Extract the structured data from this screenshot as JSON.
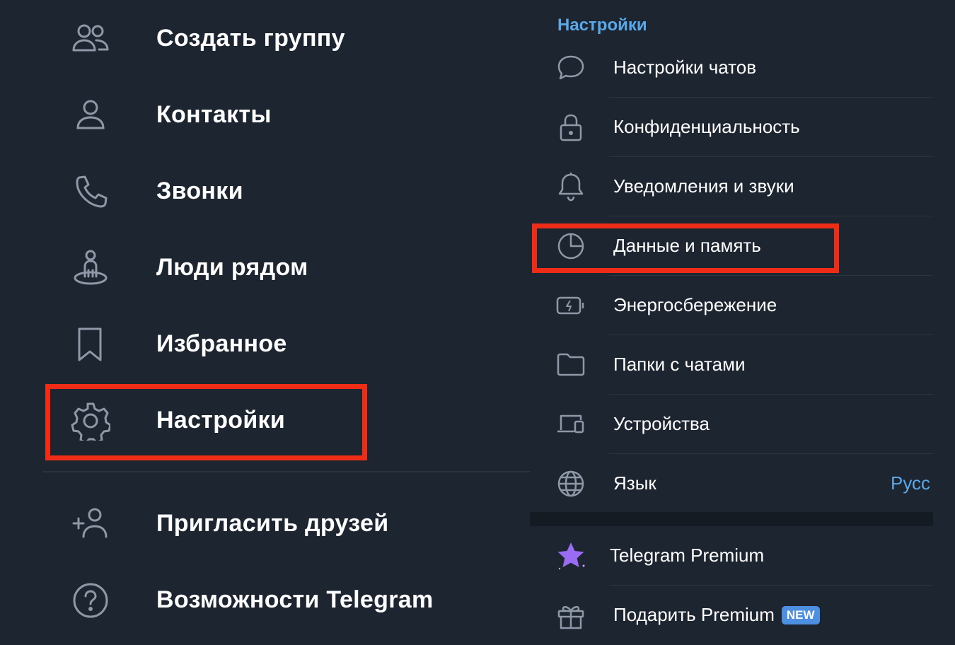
{
  "drawer": {
    "items": [
      {
        "label": "Создать группу",
        "icon": "group-icon"
      },
      {
        "label": "Контакты",
        "icon": "contact-icon"
      },
      {
        "label": "Звонки",
        "icon": "phone-icon"
      },
      {
        "label": "Люди рядом",
        "icon": "people-nearby-icon"
      },
      {
        "label": "Избранное",
        "icon": "bookmark-icon"
      },
      {
        "label": "Настройки",
        "icon": "gear-icon"
      },
      {
        "label": "Пригласить друзей",
        "icon": "add-user-icon"
      },
      {
        "label": "Возможности Telegram",
        "icon": "help-icon"
      }
    ]
  },
  "settings": {
    "header": "Настройки",
    "items": [
      {
        "label": "Настройки чатов",
        "icon": "chat-bubble-icon"
      },
      {
        "label": "Конфиденциальность",
        "icon": "lock-icon"
      },
      {
        "label": "Уведомления и звуки",
        "icon": "bell-icon"
      },
      {
        "label": "Данные и память",
        "icon": "pie-chart-icon"
      },
      {
        "label": "Энергосбережение",
        "icon": "battery-icon"
      },
      {
        "label": "Папки с чатами",
        "icon": "folder-icon"
      },
      {
        "label": "Устройства",
        "icon": "devices-icon"
      },
      {
        "label": "Язык",
        "icon": "globe-icon",
        "value": "Русс"
      }
    ],
    "premium": {
      "label": "Telegram Premium",
      "icon": "premium-star-icon"
    },
    "gift": {
      "label": "Подарить Premium",
      "icon": "gift-icon",
      "badge": "NEW"
    }
  },
  "colors": {
    "background": "#1d2531",
    "accent": "#5aa8e8",
    "highlight": "#ef2d17",
    "premium": "#9a6cf2",
    "badge": "#4d8fe0"
  }
}
